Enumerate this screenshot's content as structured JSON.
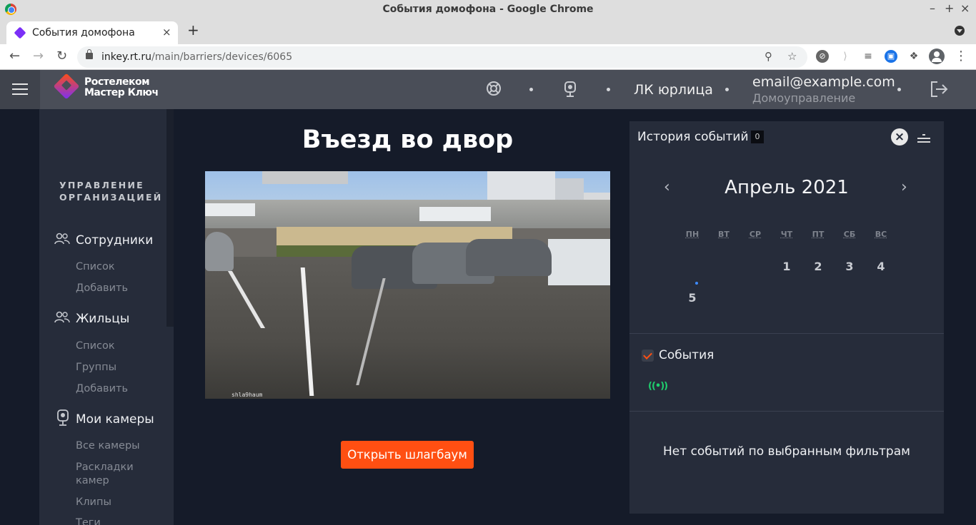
{
  "window": {
    "title": "События домофона - Google Chrome",
    "controls": [
      "–",
      "+",
      "×"
    ]
  },
  "tab": {
    "title": "События домофона",
    "close": "×",
    "new_tab": "+"
  },
  "address": {
    "host": "inkey.rt.ru",
    "path": "/main/barriers/devices/6065"
  },
  "header": {
    "logo_line1": "Ростелеком",
    "logo_line2": "Мастер Ключ",
    "account_label": "ЛК юрлица",
    "email": "email@example.com",
    "organization": "Домоуправление",
    "icons": [
      "support-icon",
      "camera-icon",
      "logout-icon"
    ]
  },
  "sidebar": {
    "section_title_line1": "УПРАВЛЕНИЕ",
    "section_title_line2": "ОРГАНИЗАЦИЕЙ",
    "groups": [
      {
        "label": "Сотрудники",
        "icon": "people-icon",
        "items": [
          "Список",
          "Добавить"
        ]
      },
      {
        "label": "Жильцы",
        "icon": "people-icon",
        "items": [
          "Список",
          "Группы",
          "Добавить"
        ]
      },
      {
        "label": "Мои камеры",
        "icon": "camera-icon",
        "items": [
          "Все камеры",
          "Раскладки камер",
          "Клипы",
          "Теги"
        ]
      }
    ]
  },
  "main": {
    "title": "Въезд во двор",
    "camera_timestamp": "shla9haum",
    "open_button": "Открыть шлагбаум"
  },
  "events_panel": {
    "title": "История событий",
    "count": "0",
    "calendar": {
      "month_label": "Апрель 2021",
      "weekdays": [
        "ПН",
        "ВТ",
        "СР",
        "ЧТ",
        "ПТ",
        "СБ",
        "ВС"
      ],
      "days": [
        "1",
        "2",
        "3",
        "4",
        "5"
      ]
    },
    "filter_label": "События",
    "filter_icon": "broadcast-icon",
    "empty_text": "Нет событий по выбранным фильтрам"
  },
  "colors": {
    "accent": "#ff4f12",
    "brand_purple": "#7b2ff7",
    "header_bg": "#4a4e58",
    "page_bg": "#151b29",
    "panel_bg": "#262c3a",
    "signal_green": "#1fcf6e"
  }
}
